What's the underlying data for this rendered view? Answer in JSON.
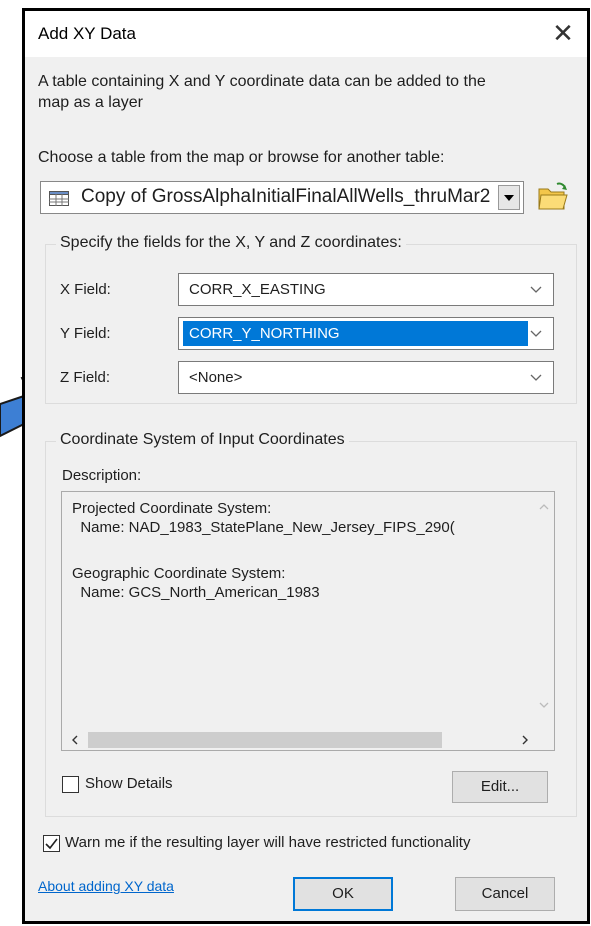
{
  "dialog": {
    "title": "Add XY Data",
    "close_glyph": "✕",
    "intro": [
      "A table containing X and Y coordinate data can be added to the",
      "map as a layer"
    ],
    "choose_label": "Choose a table from the map or browse for another table:",
    "table_value": "Copy of GrossAlphaInitialFinalAllWells_thruMar2",
    "browse_icon": "folder-open-icon"
  },
  "fields": {
    "group_title": "Specify the fields for the X, Y and Z coordinates:",
    "x_label": "X Field:",
    "x_value": "CORR_X_EASTING",
    "y_label": "Y Field:",
    "y_value": "CORR_Y_NORTHING",
    "z_label": "Z Field:",
    "z_value": "<None>"
  },
  "coords": {
    "group_title": "Coordinate System of Input Coordinates",
    "description_label": "Description:",
    "projected_heading": "Projected Coordinate System:",
    "projected_name": "  Name: NAD_1983_StatePlane_New_Jersey_FIPS_290(",
    "geographic_heading": "Geographic Coordinate System:",
    "geographic_name": "  Name: GCS_North_American_1983",
    "show_details": "Show Details",
    "edit": "Edit..."
  },
  "footer": {
    "warn": "Warn me if the resulting layer will have restricted functionality",
    "link": "About adding XY data",
    "ok": "OK",
    "cancel": "Cancel"
  },
  "colors": {
    "selection": "#0078d7",
    "pointer_arrow": "#3d7fd4",
    "link": "#0066cc"
  }
}
